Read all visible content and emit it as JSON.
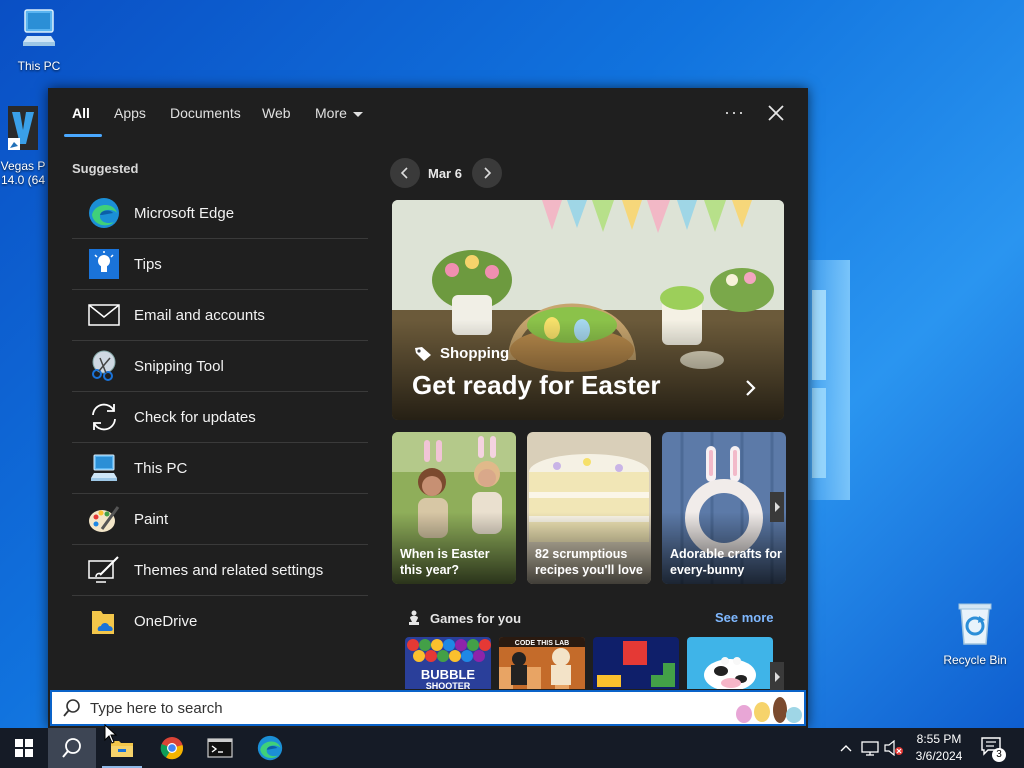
{
  "desktop": {
    "icons": [
      {
        "label": "This PC",
        "icon": "this-pc-icon"
      },
      {
        "label": "Vegas P 14.0 (64",
        "icon": "vegas-pro-icon"
      },
      {
        "label": "Recycle Bin",
        "icon": "recycle-bin-icon"
      }
    ]
  },
  "search_panel": {
    "tabs": [
      {
        "label": "All",
        "active": true
      },
      {
        "label": "Apps"
      },
      {
        "label": "Documents"
      },
      {
        "label": "Web"
      },
      {
        "label": "More"
      }
    ],
    "options_label": "···",
    "suggested_title": "Suggested",
    "suggested": [
      {
        "label": "Microsoft Edge",
        "icon": "edge-icon"
      },
      {
        "label": "Tips",
        "icon": "tips-icon"
      },
      {
        "label": "Email and accounts",
        "icon": "mail-icon"
      },
      {
        "label": "Snipping Tool",
        "icon": "snipping-tool-icon"
      },
      {
        "label": "Check for updates",
        "icon": "update-icon"
      },
      {
        "label": "This PC",
        "icon": "this-pc-icon"
      },
      {
        "label": "Paint",
        "icon": "paint-icon"
      },
      {
        "label": "Themes and related settings",
        "icon": "themes-icon"
      },
      {
        "label": "OneDrive",
        "icon": "onedrive-icon"
      }
    ],
    "date": "Mar 6",
    "hero": {
      "category": "Shopping",
      "title": "Get ready for Easter"
    },
    "cards": [
      {
        "title": "When is Easter this year?"
      },
      {
        "title": "82 scrumptious recipes you'll love"
      },
      {
        "title": "Adorable crafts for every-bunny"
      }
    ],
    "games": {
      "title": "Games for you",
      "see_more": "See more",
      "items": [
        {
          "name": "BUBBLE SHOOTER",
          "icon": "bubble-shooter-tile"
        },
        {
          "name": "CODE THIS LAB",
          "icon": "chess-game-tile"
        },
        {
          "name": "",
          "icon": "block-puzzle-tile"
        },
        {
          "name": "",
          "icon": "cow-game-tile"
        }
      ]
    }
  },
  "search": {
    "placeholder": "Type here to search"
  },
  "taskbar": {
    "apps": [
      {
        "name": "start",
        "icon": "windows-start-icon"
      },
      {
        "name": "search",
        "icon": "search-icon"
      },
      {
        "name": "file-explorer",
        "icon": "file-explorer-icon"
      },
      {
        "name": "chrome",
        "icon": "chrome-icon"
      },
      {
        "name": "terminal",
        "icon": "terminal-icon"
      },
      {
        "name": "edge",
        "icon": "edge-icon"
      }
    ],
    "time": "8:55 PM",
    "date": "3/6/2024",
    "notifications": "3"
  },
  "colors": {
    "accent": "#4aa8ff",
    "panel": "#1f1f1f",
    "taskbar": "#151b26",
    "link": "#7fb8ff"
  }
}
